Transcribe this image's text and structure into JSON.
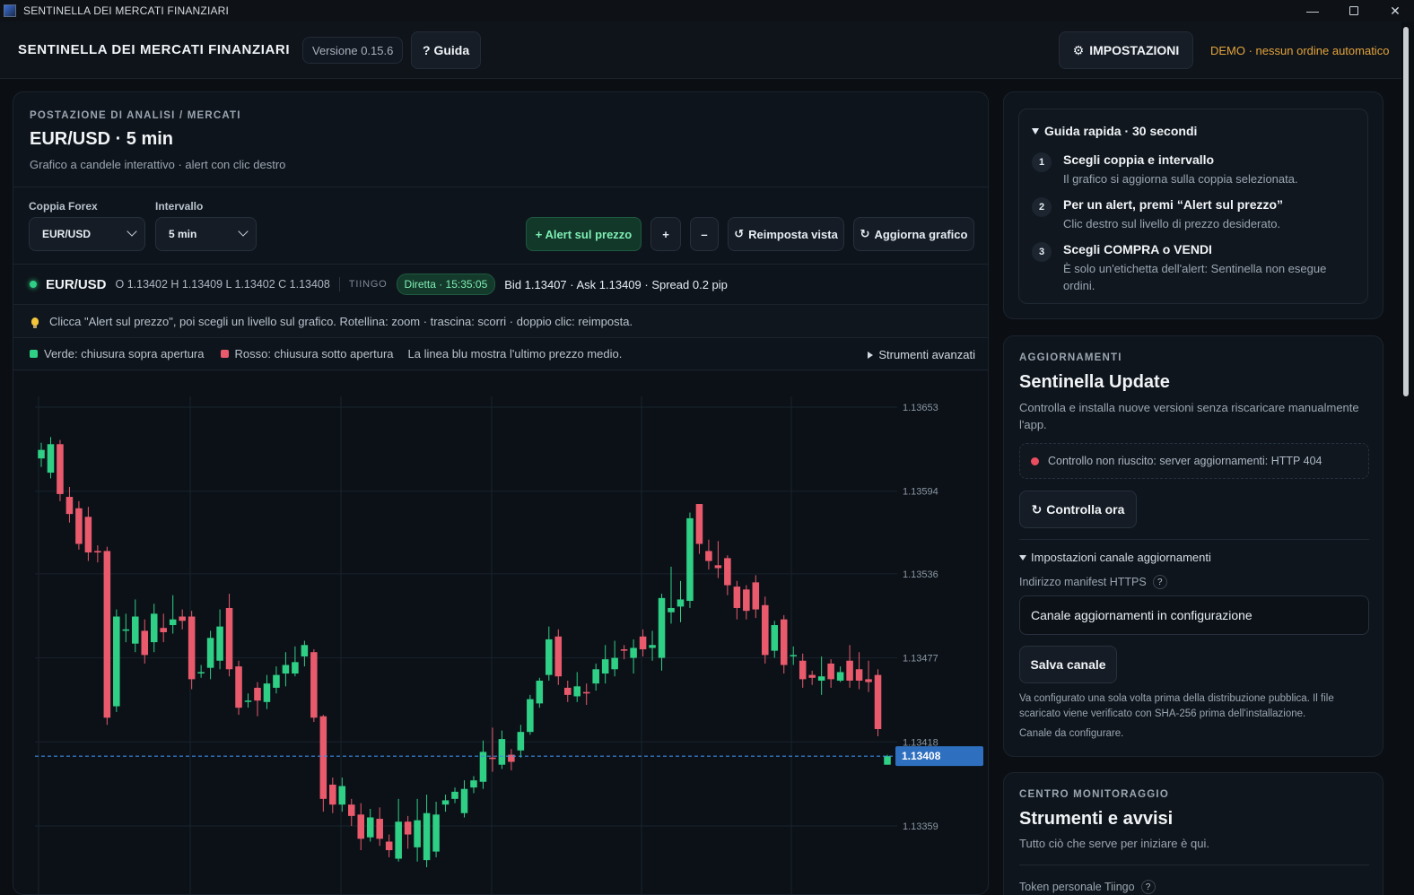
{
  "window": {
    "title": "SENTINELLA DEI MERCATI FINANZIARI"
  },
  "header": {
    "brand": "SENTINELLA DEI MERCATI FINANZIARI",
    "version": "Versione 0.15.6",
    "guide_label": "? Guida",
    "settings_label": "IMPOSTAZIONI",
    "demo_note": "DEMO · nessun ordine automatico"
  },
  "workspace": {
    "kicker": "POSTAZIONE DI ANALISI / MERCATI",
    "title": "EUR/USD · 5 min",
    "subtitle": "Grafico a candele interattivo · alert con clic destro",
    "pair_label": "Coppia Forex",
    "pair_value": "EUR/USD",
    "interval_label": "Intervallo",
    "interval_value": "5 min",
    "toolbar": {
      "alert": "+ Alert sul prezzo",
      "zoom_in": "+",
      "zoom_out": "–",
      "reset": "Reimposta vista",
      "refresh": "Aggiorna grafico"
    },
    "quote": {
      "pair": "EUR/USD",
      "ohlc": "O 1.13402 H 1.13409 L 1.13402 C 1.13408",
      "source": "TIINGO",
      "live": "Diretta · 15:35:05",
      "bid_ask": "Bid 1.13407 · Ask 1.13409 · Spread 0.2 pip"
    },
    "hint": "Clicca \"Alert sul prezzo\", poi scegli un livello sul grafico. Rotellina: zoom · trascina: scorri · doppio clic: reimposta.",
    "legend": {
      "green": "Verde: chiusura sopra apertura",
      "red": "Rosso: chiusura sotto apertura",
      "note": "La linea blu mostra l'ultimo prezzo medio.",
      "advanced": "Strumenti avanzati"
    }
  },
  "chart_data": {
    "type": "candlestick",
    "y_ticks": [
      1.13653,
      1.13594,
      1.13536,
      1.13477,
      1.13418,
      1.13359
    ],
    "last_price": 1.13408,
    "colors": {
      "up": "#2fcf86",
      "down": "#ea5a6d",
      "last": "#3d8ee8"
    },
    "candles": [
      [
        1.13617,
        1.13623,
        1.13611,
        1.13628
      ],
      [
        1.13607,
        1.13627,
        1.13603,
        1.13632
      ],
      [
        1.13627,
        1.13592,
        1.13587,
        1.1363
      ],
      [
        1.1359,
        1.13578,
        1.13572,
        1.13597
      ],
      [
        1.13582,
        1.13557,
        1.13553,
        1.13587
      ],
      [
        1.13576,
        1.13551,
        1.13545,
        1.13583
      ],
      [
        1.13552,
        1.13551,
        1.13544,
        1.13556
      ],
      [
        1.13552,
        1.13435,
        1.1343,
        1.13555
      ],
      [
        1.13443,
        1.13506,
        1.13439,
        1.13511
      ],
      [
        1.13496,
        1.13497,
        1.13488,
        1.13508
      ],
      [
        1.13487,
        1.13506,
        1.13481,
        1.13518
      ],
      [
        1.13496,
        1.13479,
        1.13473,
        1.13504
      ],
      [
        1.13488,
        1.13508,
        1.13481,
        1.13515
      ],
      [
        1.13498,
        1.13495,
        1.13488,
        1.13508
      ],
      [
        1.135,
        1.13504,
        1.13494,
        1.13521
      ],
      [
        1.13506,
        1.13503,
        1.13497,
        1.13511
      ],
      [
        1.13506,
        1.13462,
        1.13455,
        1.1351
      ],
      [
        1.13467,
        1.13467,
        1.13463,
        1.13472
      ],
      [
        1.1347,
        1.13491,
        1.13462,
        1.13496
      ],
      [
        1.13475,
        1.13499,
        1.13469,
        1.13511
      ],
      [
        1.13512,
        1.13469,
        1.13464,
        1.13522
      ],
      [
        1.13471,
        1.13442,
        1.13437,
        1.13475
      ],
      [
        1.13447,
        1.13447,
        1.13442,
        1.13452
      ],
      [
        1.13456,
        1.13447,
        1.13436,
        1.1346
      ],
      [
        1.13446,
        1.13459,
        1.13441,
        1.13465
      ],
      [
        1.13456,
        1.13465,
        1.13452,
        1.13471
      ],
      [
        1.13466,
        1.13472,
        1.13457,
        1.13481
      ],
      [
        1.13466,
        1.13474,
        1.13464,
        1.13485
      ],
      [
        1.13478,
        1.13486,
        1.13471,
        1.13489
      ],
      [
        1.13481,
        1.13435,
        1.13432,
        1.13483
      ],
      [
        1.13436,
        1.13378,
        1.13369,
        1.13437
      ],
      [
        1.13388,
        1.13374,
        1.13368,
        1.13393
      ],
      [
        1.13374,
        1.13387,
        1.13369,
        1.13393
      ],
      [
        1.13374,
        1.13366,
        1.13359,
        1.13378
      ],
      [
        1.13367,
        1.1335,
        1.13342,
        1.13375
      ],
      [
        1.13351,
        1.13365,
        1.13348,
        1.13371
      ],
      [
        1.13364,
        1.1335,
        1.13345,
        1.13372
      ],
      [
        1.13348,
        1.13342,
        1.13337,
        1.13353
      ],
      [
        1.13336,
        1.13362,
        1.13334,
        1.13378
      ],
      [
        1.13362,
        1.13353,
        1.13343,
        1.13366
      ],
      [
        1.13344,
        1.13363,
        1.13334,
        1.13378
      ],
      [
        1.13335,
        1.13368,
        1.1333,
        1.13381
      ],
      [
        1.13341,
        1.13367,
        1.13337,
        1.13376
      ],
      [
        1.13374,
        1.13377,
        1.13369,
        1.13381
      ],
      [
        1.13378,
        1.13383,
        1.13375,
        1.13386
      ],
      [
        1.13368,
        1.13385,
        1.13365,
        1.13391
      ],
      [
        1.13386,
        1.13391,
        1.13382,
        1.13394
      ],
      [
        1.1339,
        1.13411,
        1.13385,
        1.13419
      ],
      [
        1.13407,
        1.13406,
        1.13397,
        1.13428
      ],
      [
        1.13402,
        1.1342,
        1.13399,
        1.13426
      ],
      [
        1.13409,
        1.13404,
        1.13398,
        1.13413
      ],
      [
        1.13412,
        1.13425,
        1.13407,
        1.1343
      ],
      [
        1.13425,
        1.13448,
        1.13423,
        1.13451
      ],
      [
        1.13445,
        1.13461,
        1.13442,
        1.13463
      ],
      [
        1.13465,
        1.1349,
        1.13461,
        1.13499
      ],
      [
        1.13492,
        1.13464,
        1.13458,
        1.13497
      ],
      [
        1.13456,
        1.13451,
        1.13446,
        1.13461
      ],
      [
        1.1345,
        1.13457,
        1.13446,
        1.13467
      ],
      [
        1.13453,
        1.13452,
        1.13444,
        1.13459
      ],
      [
        1.13459,
        1.13469,
        1.13454,
        1.13473
      ],
      [
        1.13466,
        1.13476,
        1.13459,
        1.13486
      ],
      [
        1.13469,
        1.13477,
        1.13464,
        1.13489
      ],
      [
        1.13483,
        1.13482,
        1.13476,
        1.13486
      ],
      [
        1.13477,
        1.13484,
        1.13466,
        1.1349
      ],
      [
        1.13492,
        1.13483,
        1.13478,
        1.13497
      ],
      [
        1.13484,
        1.13486,
        1.13475,
        1.13496
      ],
      [
        1.13477,
        1.13519,
        1.13468,
        1.13522
      ],
      [
        1.13509,
        1.13512,
        1.13501,
        1.13541
      ],
      [
        1.13513,
        1.13518,
        1.13502,
        1.13531
      ],
      [
        1.13517,
        1.13575,
        1.13512,
        1.13579
      ],
      [
        1.13585,
        1.13557,
        1.1355,
        1.13582
      ],
      [
        1.13552,
        1.13545,
        1.13539,
        1.1356
      ],
      [
        1.13542,
        1.1354,
        1.13533,
        1.13559
      ],
      [
        1.13547,
        1.13528,
        1.13521,
        1.13549
      ],
      [
        1.13527,
        1.13512,
        1.13504,
        1.13531
      ],
      [
        1.13525,
        1.1351,
        1.13504,
        1.13528
      ],
      [
        1.1353,
        1.13511,
        1.13505,
        1.13535
      ],
      [
        1.13514,
        1.13479,
        1.13473,
        1.1352
      ],
      [
        1.13482,
        1.135,
        1.13477,
        1.13503
      ],
      [
        1.13504,
        1.13472,
        1.13466,
        1.13507
      ],
      [
        1.13479,
        1.13479,
        1.13472,
        1.13485
      ],
      [
        1.13475,
        1.13462,
        1.13456,
        1.1348
      ],
      [
        1.13465,
        1.13463,
        1.13458,
        1.13468
      ],
      [
        1.13461,
        1.13464,
        1.13451,
        1.13478
      ],
      [
        1.13473,
        1.13462,
        1.13456,
        1.13476
      ],
      [
        1.13461,
        1.13467,
        1.1346,
        1.13471
      ],
      [
        1.13475,
        1.13461,
        1.13456,
        1.13486
      ],
      [
        1.13469,
        1.13461,
        1.13455,
        1.13481
      ],
      [
        1.13462,
        1.1346,
        1.13453,
        1.13475
      ],
      [
        1.13465,
        1.13427,
        1.13422,
        1.13469
      ],
      [
        1.13402,
        1.13408,
        1.13402,
        1.13409
      ]
    ]
  },
  "guide": {
    "head": "Guida rapida · 30 secondi",
    "steps": [
      {
        "n": "1",
        "title": "Scegli coppia e intervallo",
        "desc": "Il grafico si aggiorna sulla coppia selezionata."
      },
      {
        "n": "2",
        "title": "Per un alert, premi “Alert sul prezzo”",
        "desc": "Clic destro sul livello di prezzo desiderato."
      },
      {
        "n": "3",
        "title": "Scegli COMPRA o VENDI",
        "desc": "È solo un'etichetta dell'alert: Sentinella non esegue ordini."
      }
    ]
  },
  "updates": {
    "kicker": "AGGIORNAMENTI",
    "title": "Sentinella Update",
    "desc": "Controlla e installa nuove versioni senza riscaricare manualmente l'app.",
    "status": "Controllo non riuscito: server aggiornamenti: HTTP 404",
    "check_label": "Controlla ora",
    "channel_head": "Impostazioni canale aggiornamenti",
    "manifest_label": "Indirizzo manifest HTTPS",
    "manifest_value": "Canale aggiornamenti in configurazione",
    "save_label": "Salva canale",
    "note": "Va configurato una sola volta prima della distribuzione pubblica. Il file scaricato viene verificato con SHA-256 prima dell'installazione.",
    "note2": "Canale da configurare."
  },
  "monitor": {
    "kicker": "CENTRO MONITORAGGIO",
    "title": "Strumenti e avvisi",
    "desc": "Tutto ciò che serve per iniziare è qui.",
    "token_label": "Token personale Tiingo"
  }
}
